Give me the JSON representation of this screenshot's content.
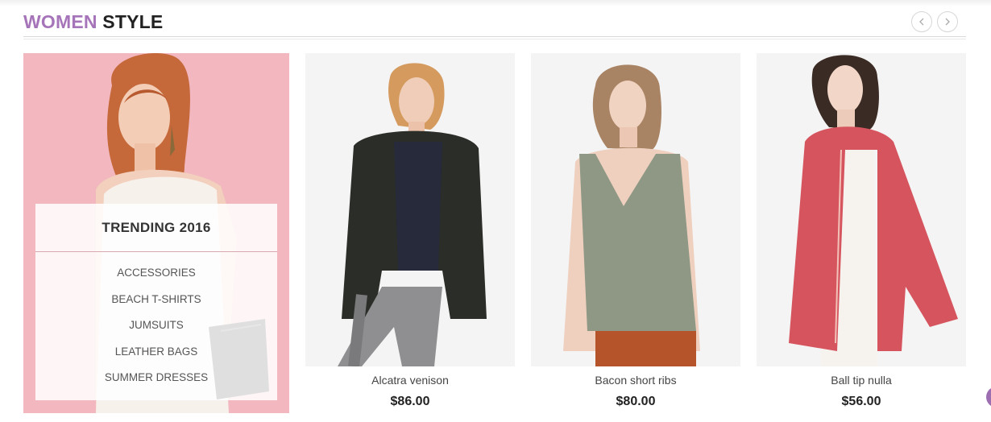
{
  "section": {
    "title_accent": "WOMEN",
    "title_rest": " STYLE",
    "accent_color": "#a674b8"
  },
  "nav": {
    "prev_icon": "chevron-left-icon",
    "next_icon": "chevron-right-icon"
  },
  "promo": {
    "background_color": "#f2b7bf",
    "title": "TRENDING 2016",
    "items": [
      "ACCESSORIES",
      "BEACH T-SHIRTS",
      "JUMSUITS",
      "LEATHER BAGS",
      "SUMMER DRESSES"
    ]
  },
  "products": [
    {
      "name": "Alcatra venison",
      "price": "$86.00"
    },
    {
      "name": "Bacon short ribs",
      "price": "$80.00"
    },
    {
      "name": "Ball tip nulla",
      "price": "$56.00"
    }
  ]
}
